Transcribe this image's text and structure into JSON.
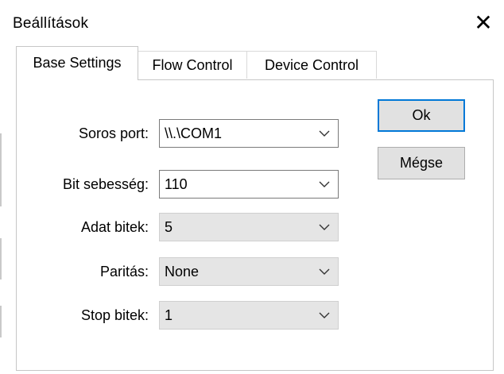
{
  "window": {
    "title": "Beállítások",
    "close_icon": "close-icon"
  },
  "tabs": [
    {
      "label": "Base Settings",
      "active": true
    },
    {
      "label": "Flow Control",
      "active": false
    },
    {
      "label": "Device Control",
      "active": false
    }
  ],
  "buttons": {
    "ok_label": "Ok",
    "cancel_label": "Mégse"
  },
  "fields": [
    {
      "label": "Soros port:",
      "value": "\\\\.\\COM1",
      "editable": true
    },
    {
      "label": "Bit sebesség:",
      "value": "110",
      "editable": true
    },
    {
      "label": "Adat bitek:",
      "value": "5",
      "editable": false
    },
    {
      "label": "Paritás:",
      "value": "None",
      "editable": false
    },
    {
      "label": "Stop bitek:",
      "value": "1",
      "editable": false
    }
  ],
  "colors": {
    "accent": "#0078d7",
    "button_face": "#e1e1e1",
    "readonly_combo": "#e5e5e5"
  }
}
